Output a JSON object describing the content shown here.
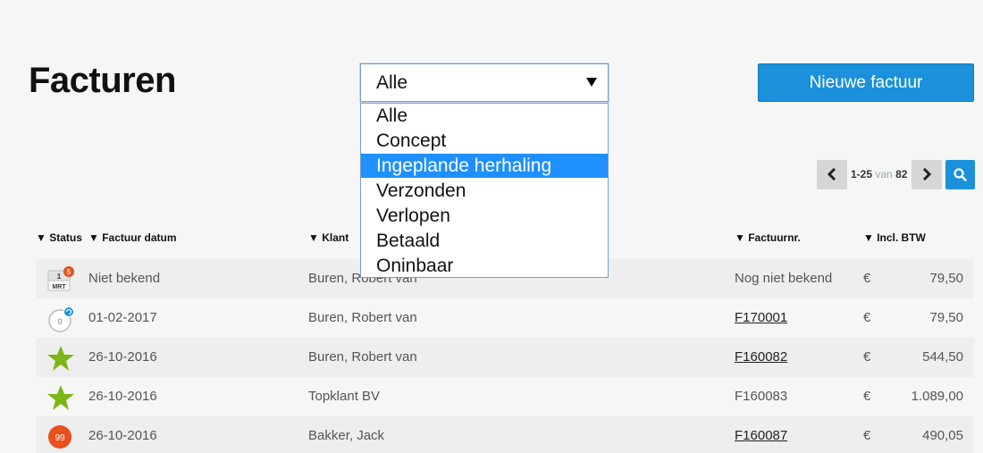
{
  "page": {
    "title": "Facturen",
    "new_invoice_label": "Nieuwe factuur"
  },
  "filter": {
    "selected": "Alle",
    "options": [
      "Alle",
      "Concept",
      "Ingeplande herhaling",
      "Verzonden",
      "Verlopen",
      "Betaald",
      "Oninbaar"
    ],
    "highlighted": "Ingeplande herhaling"
  },
  "pagination": {
    "range": "1-25",
    "of_label": "van",
    "total": "82"
  },
  "colors": {
    "accent": "#1a91da",
    "dropdown_highlight": "#1e90ff",
    "star": "#7cb518",
    "badge_orange": "#e8501e"
  },
  "table": {
    "columns": {
      "status": "▼ Status",
      "date": "▼ Factuur datum",
      "client": "▼ Klant",
      "number": "▼ Factuurnr.",
      "total": "▼ Incl. BTW"
    },
    "rows": [
      {
        "status_icon": "calendar-icon",
        "calendar_day": "1",
        "calendar_month": "MRT",
        "badge": "5",
        "date": "Niet bekend",
        "client": "Buren, Robert van",
        "number": "Nog niet bekend",
        "currency": "€",
        "amount": "79,50"
      },
      {
        "status_icon": "recurring-clock-icon",
        "clock_label": "0",
        "date": "01-02-2017",
        "client": "Buren, Robert van",
        "number": "F170001",
        "currency": "€",
        "amount": "79,50"
      },
      {
        "status_icon": "star-icon",
        "date": "26-10-2016",
        "client": "Buren, Robert van",
        "number": "F160082",
        "currency": "€",
        "amount": "544,50"
      },
      {
        "status_icon": "star-icon",
        "date": "26-10-2016",
        "client": "Topklant BV",
        "number": "F160083",
        "currency": "€",
        "amount": "1.089,00"
      },
      {
        "status_icon": "overdue-badge-icon",
        "badge": "99",
        "date": "26-10-2016",
        "client": "Bakker, Jack",
        "number": "F160087",
        "currency": "€",
        "amount": "490,05"
      }
    ]
  }
}
